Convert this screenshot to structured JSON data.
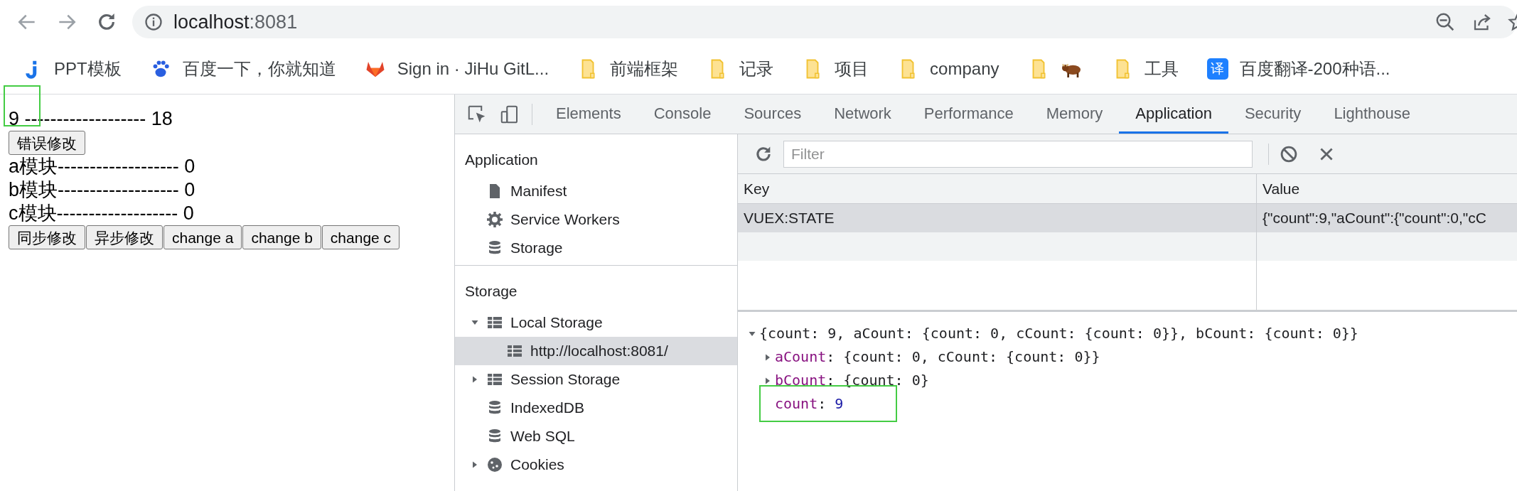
{
  "browser": {
    "address": {
      "host": "localhost",
      "port": ":8081"
    },
    "bookmarks": [
      {
        "kind": "jlogo",
        "label": "PPT模板"
      },
      {
        "kind": "paw",
        "label": "百度一下，你就知道"
      },
      {
        "kind": "fox",
        "label": "Sign in · JiHu GitL..."
      },
      {
        "kind": "folder",
        "label": "前端框架"
      },
      {
        "kind": "folder",
        "label": "记录"
      },
      {
        "kind": "folder",
        "label": "项目"
      },
      {
        "kind": "folder",
        "label": "company"
      },
      {
        "kind": "pet"
      },
      {
        "kind": "folder",
        "label": "工具"
      },
      {
        "kind": "translate",
        "icon_text": "译",
        "label": "百度翻译-200种语..."
      }
    ]
  },
  "page": {
    "count_line": "9 ------------------- 18",
    "fix_button": "错误修改",
    "module_lines": [
      "a模块------------------- 0",
      "b模块------------------- 0",
      "c模块------------------- 0"
    ],
    "buttons": [
      "同步修改",
      "异步修改",
      "change a",
      "change b",
      "change c"
    ]
  },
  "devtools": {
    "tabs": [
      {
        "label": "Elements",
        "selected": false
      },
      {
        "label": "Console",
        "selected": false
      },
      {
        "label": "Sources",
        "selected": false
      },
      {
        "label": "Network",
        "selected": false
      },
      {
        "label": "Performance",
        "selected": false
      },
      {
        "label": "Memory",
        "selected": false
      },
      {
        "label": "Application",
        "selected": true
      },
      {
        "label": "Security",
        "selected": false
      },
      {
        "label": "Lighthouse",
        "selected": false
      }
    ],
    "sidebar": [
      {
        "heading": "Application",
        "items": [
          {
            "kind": "file",
            "label": "Manifest",
            "selected": false
          },
          {
            "kind": "gear",
            "label": "Service Workers",
            "selected": false
          },
          {
            "kind": "database",
            "label": "Storage",
            "selected": false
          }
        ]
      },
      {
        "heading": "Storage",
        "items": [
          {
            "kind": "grid",
            "label": "Local Storage",
            "selected": false,
            "expanded": true,
            "children": [
              {
                "kind": "grid",
                "label": "http://localhost:8081/",
                "selected": true
              }
            ]
          },
          {
            "kind": "grid",
            "label": "Session Storage",
            "selected": false,
            "expanded": false
          },
          {
            "kind": "database",
            "label": "IndexedDB",
            "selected": false
          },
          {
            "kind": "database",
            "label": "Web SQL",
            "selected": false
          },
          {
            "kind": "cookie",
            "label": "Cookies",
            "selected": false,
            "expanded": false
          }
        ]
      }
    ],
    "filter": {
      "placeholder": "Filter"
    },
    "table": {
      "columns": [
        "Key",
        "Value"
      ],
      "rows": [
        {
          "cells": [
            "VUEX:STATE",
            "{\"count\":9,\"aCount\":{\"count\":0,\"cC"
          ],
          "selected": true
        }
      ]
    },
    "preview": {
      "summary": "{count: 9, aCount: {count: 0, cCount: {count: 0}}, bCount: {count: 0}}",
      "expanded": true,
      "children": [
        {
          "key": "aCount",
          "colon": ":",
          "value": "{count: 0, cCount: {count: 0}}",
          "expanded": false
        },
        {
          "key": "bCount",
          "colon": ":",
          "value": "{count: 0}",
          "expanded": false
        },
        {
          "key": "count",
          "colon": ":",
          "value": "9"
        }
      ]
    }
  }
}
